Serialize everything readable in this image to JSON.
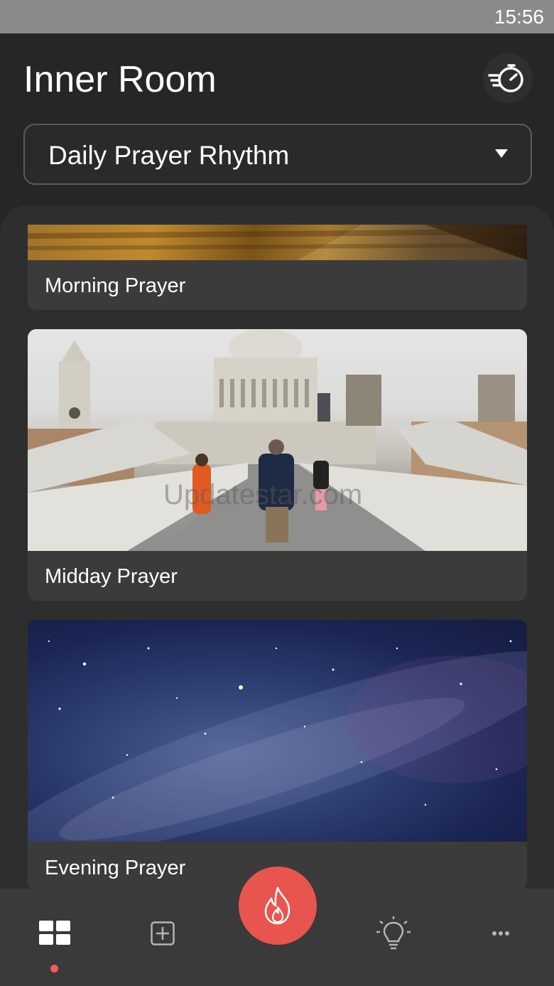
{
  "status_bar": {
    "time": "15:56"
  },
  "header": {
    "title": "Inner Room",
    "timer_icon": "stopwatch-speed-icon"
  },
  "rhythm_selector": {
    "selected": "Daily Prayer Rhythm",
    "caret_icon": "caret-down-icon"
  },
  "prayers": [
    {
      "label": "Morning Prayer",
      "image": "sunrise-field-image"
    },
    {
      "label": "Midday Prayer",
      "image": "city-bridge-cathedral-image"
    },
    {
      "label": "Evening Prayer",
      "image": "milky-way-night-sky-image"
    }
  ],
  "watermark": "Updatestar.com",
  "bottom_nav": {
    "items": [
      {
        "icon": "grid-icon",
        "active": true
      },
      {
        "icon": "add-square-icon",
        "active": false
      },
      {
        "icon": "lightbulb-icon",
        "active": false
      },
      {
        "icon": "more-icon",
        "active": false
      }
    ],
    "fab_icon": "flame-icon",
    "accent": "#e8554f"
  }
}
